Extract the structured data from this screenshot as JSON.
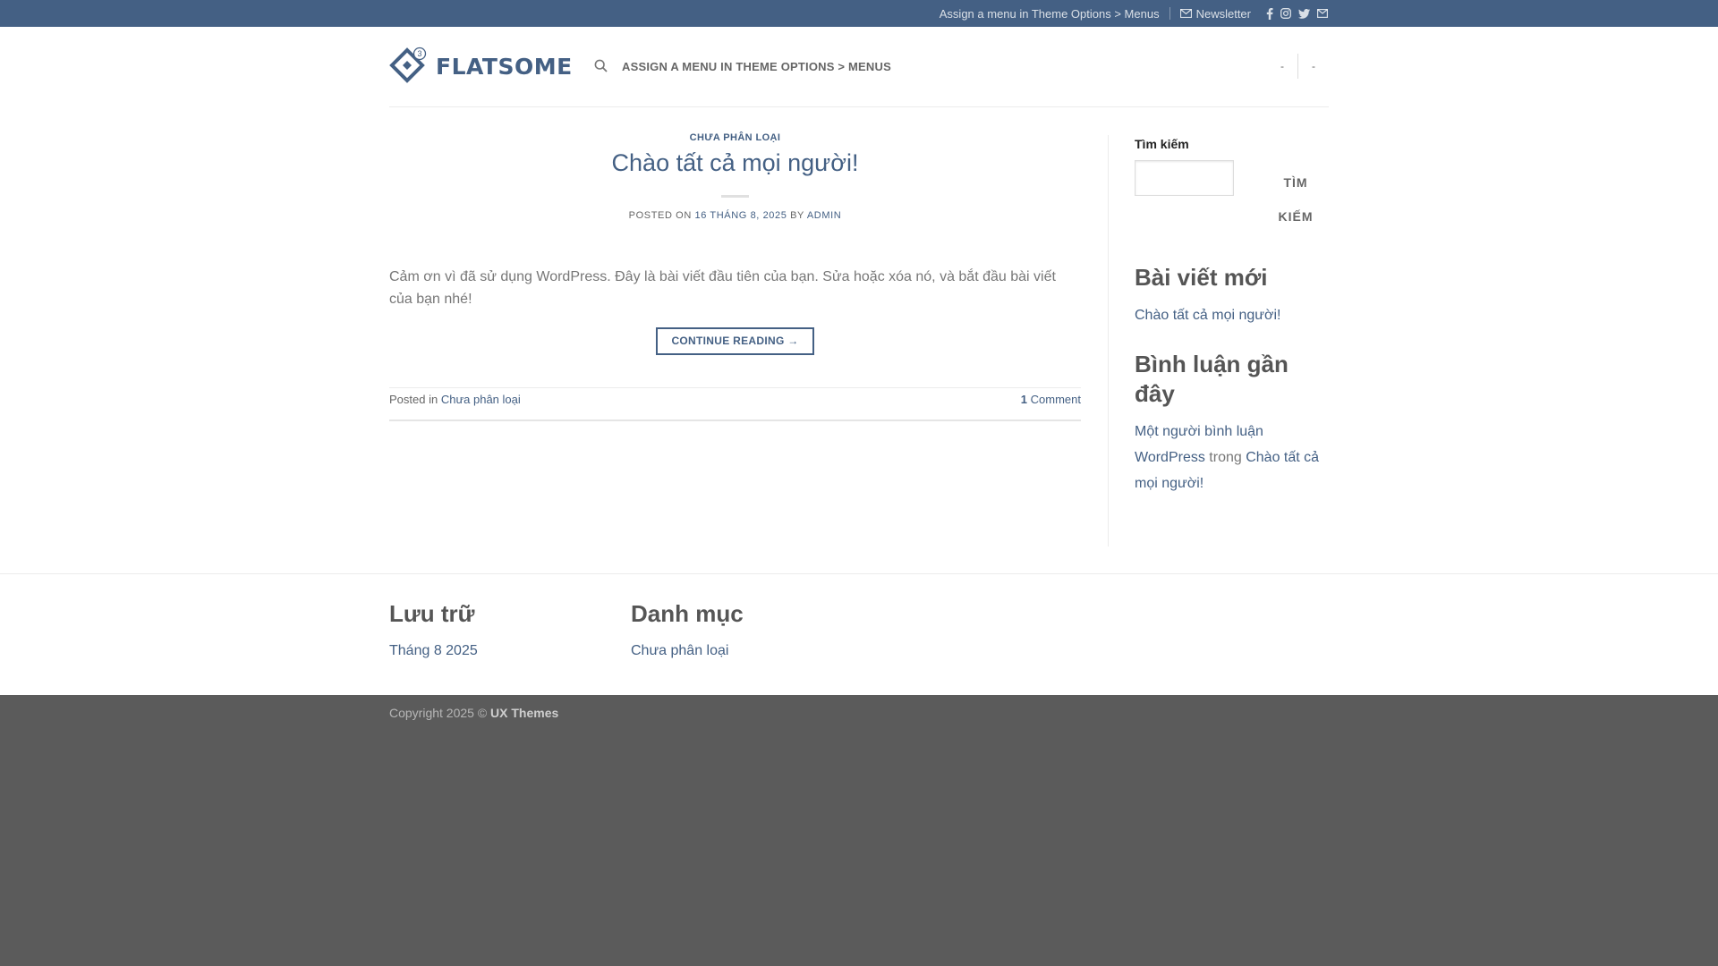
{
  "topbar": {
    "menu_text": "Assign a menu in Theme Options > Menus",
    "newsletter_label": "Newsletter",
    "socials": [
      "facebook-icon",
      "instagram-icon",
      "twitter-icon",
      "envelope-icon"
    ]
  },
  "header": {
    "logo_text": "FLATSOME",
    "logo_badge": "3",
    "nav_link": "ASSIGN A MENU IN THEME OPTIONS > MENUS",
    "right_items": [
      "-",
      "-"
    ]
  },
  "post": {
    "category": "CHƯA PHÂN LOẠI",
    "title": "Chào tất cả mọi người!",
    "meta_prefix": "POSTED ON",
    "meta_date": "16 THÁNG 8, 2025",
    "meta_by": "BY",
    "meta_author": "ADMIN",
    "excerpt": "Cảm ơn vì đã sử dụng WordPress. Đây là bài viết đầu tiên của bạn. Sửa hoặc xóa nó, và bắt đầu bài viết của bạn nhé!",
    "continue_label": "CONTINUE READING →",
    "posted_in_label": "Posted in",
    "posted_in_category": "Chưa phân loại",
    "comments_count": "1",
    "comments_label": "Comment"
  },
  "sidebar": {
    "search_label": "Tìm kiếm",
    "search_value": "",
    "search_button_line1": "TÌM",
    "search_button_line2": "KIẾM",
    "recent_posts_title": "Bài viết mới",
    "recent_post_1": "Chào tất cả mọi người!",
    "recent_comments_title_line1": "Bình luận gần",
    "recent_comments_title_line2": "đây",
    "comment_author_line1": "Một người bình luận",
    "comment_author_line2": "WordPress",
    "comment_in": "trong",
    "comment_post_line1": "Chào tất cả",
    "comment_post_line2": "mọi người!"
  },
  "footer_widgets": {
    "archives_title": "Lưu trữ",
    "archive_1": "Tháng 8 2025",
    "categories_title": "Danh mục",
    "category_1": "Chưa phân loại"
  },
  "copyright": {
    "text": "Copyright 2025 ©",
    "brand": "UX Themes"
  },
  "colors": {
    "primary": "#446084",
    "footer_bg": "#5b5b5b"
  }
}
